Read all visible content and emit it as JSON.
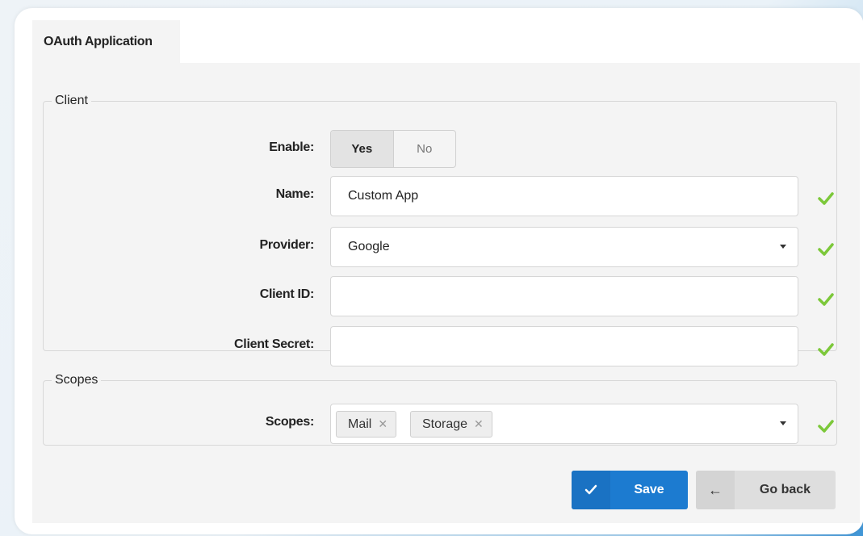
{
  "tab": {
    "title": "OAuth Application"
  },
  "client": {
    "legend": "Client",
    "enable": {
      "label": "Enable:",
      "yes": "Yes",
      "no": "No",
      "selected": "Yes"
    },
    "name": {
      "label": "Name:",
      "value": "Custom App"
    },
    "provider": {
      "label": "Provider:",
      "value": "Google"
    },
    "client_id": {
      "label": "Client ID:",
      "value": ""
    },
    "client_secret": {
      "label": "Client Secret:",
      "value": ""
    }
  },
  "scopes": {
    "legend": "Scopes",
    "label": "Scopes:",
    "chips": [
      "Mail",
      "Storage"
    ],
    "remove_glyph": "✕"
  },
  "actions": {
    "save_label": "Save",
    "back_label": "Go back",
    "back_glyph": "←"
  },
  "colors": {
    "primary": "#1c7bd0",
    "valid_check": "#7cc83a"
  }
}
